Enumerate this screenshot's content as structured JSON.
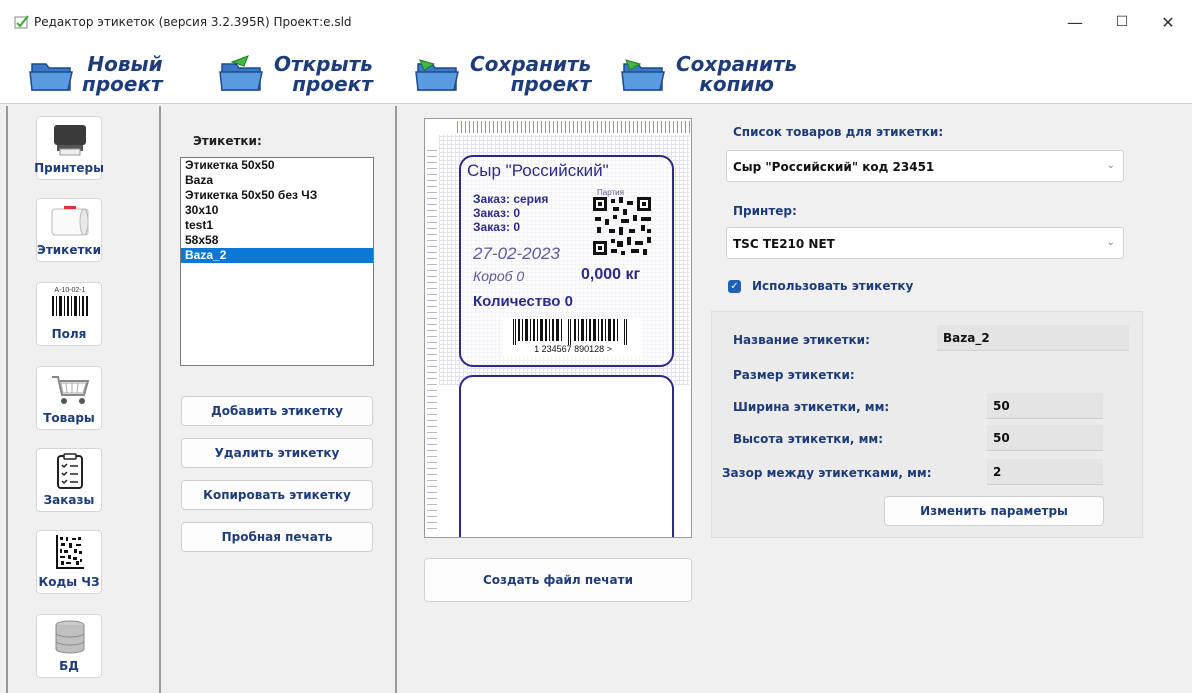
{
  "window": {
    "title": "Редактор этикеток (версия 3.2.395R) Проект:e.sld",
    "minimize": "—",
    "maximize": "☐",
    "close": "✕"
  },
  "toolbar": {
    "new_project": [
      "Новый",
      "проект"
    ],
    "open_project": [
      "Открыть",
      "проект"
    ],
    "save_project": [
      "Сохранить",
      "проект"
    ],
    "save_copy": [
      "Сохранить",
      "копию"
    ]
  },
  "sidebar": {
    "items": [
      {
        "label": "Принтеры",
        "icon": "printer-icon"
      },
      {
        "label": "Этикетки",
        "icon": "label-roll-icon"
      },
      {
        "label": "Поля",
        "icon": "barcode-fields-icon"
      },
      {
        "label": "Товары",
        "icon": "shopping-cart-icon"
      },
      {
        "label": "Заказы",
        "icon": "clipboard-icon"
      },
      {
        "label": "Коды ЧЗ",
        "icon": "datamatrix-icon"
      },
      {
        "label": "БД",
        "icon": "database-icon"
      }
    ],
    "fields_icon_text": "A-10-02-1"
  },
  "labels_panel": {
    "title": "Этикетки:",
    "items": [
      "Этикетка 50x50",
      "Baza",
      "Этикетка 50x50 без ЧЗ",
      "30x10",
      "test1",
      "58x58",
      "Baza_2"
    ],
    "selected": "Baza_2",
    "buttons": {
      "add": "Добавить этикетку",
      "delete": "Удалить этикетку",
      "copy": "Копировать этикетку",
      "test_print": "Пробная печать"
    }
  },
  "preview": {
    "product_name": "Сыр \"Российский\"",
    "order_series": "Заказ: серия",
    "order_1": "Заказ: 0",
    "order_2": "Заказ: 0",
    "batch": "Партия",
    "date": "27-02-2023",
    "box": "Короб 0",
    "weight": "0,000 кг",
    "quantity": "Количество 0",
    "barcode_number": "1 234567 890128 >",
    "create_print_file": "Создать файл печати"
  },
  "right_panel": {
    "products_label": "Список товаров для этикетки:",
    "product_value": "Сыр \"Российский\" код 23451",
    "printer_label": "Принтер:",
    "printer_value": "TSC TE210 NET",
    "use_label": "Использовать этикетку",
    "use_checked": true,
    "name_label": "Название этикетки:",
    "name_value": "Baza_2",
    "size_label": "Размер этикетки:",
    "width_label": "Ширина этикетки, мм:",
    "width_value": "50",
    "height_label": "Высота этикетки, мм:",
    "height_value": "50",
    "gap_label": "Зазор между этикетками, мм:",
    "gap_value": "2",
    "change_params": "Изменить параметры"
  },
  "colors": {
    "accent": "#1f3c7a",
    "selection": "#0a78d7",
    "label_ink": "#2a2a8a"
  }
}
